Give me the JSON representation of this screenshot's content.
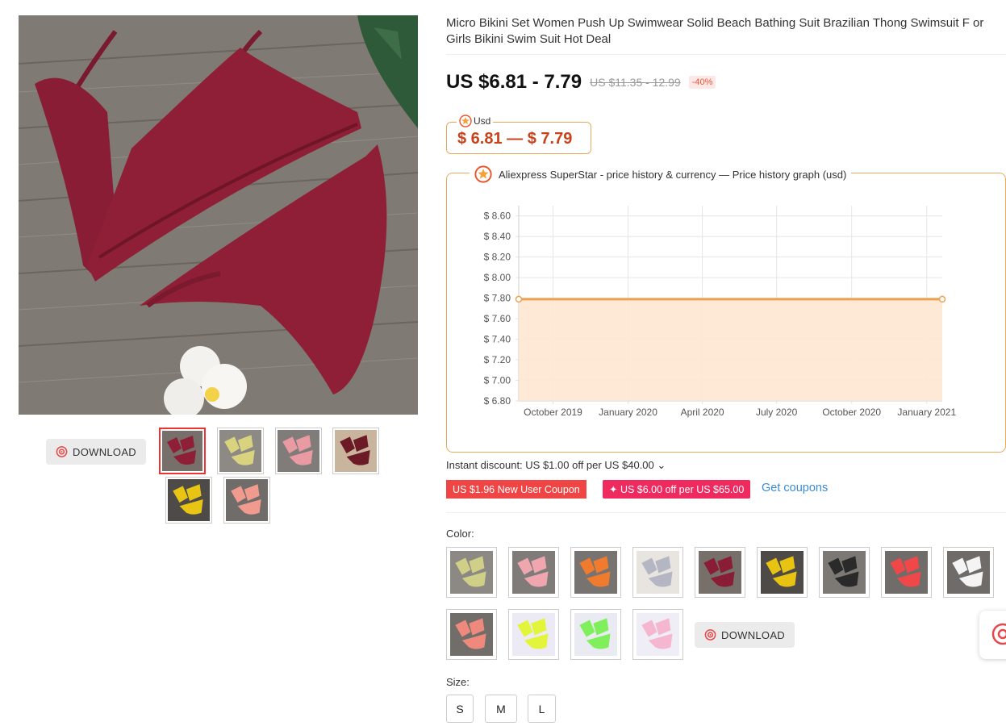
{
  "product": {
    "title": "Micro Bikini Set Women Push Up Swimwear Solid Beach Bathing Suit Brazilian Thong Swimsuit F or Girls Bikini Swim Suit Hot Deal",
    "price": "US $6.81 - 7.79",
    "old_price": "US $11.35 - 12.99",
    "discount": "-40%"
  },
  "gallery": {
    "download_label": "DOWNLOAD",
    "thumbnails": [
      {
        "color": "#8e1f37",
        "bg": "#77706a",
        "active": true
      },
      {
        "color": "#d9d27e",
        "bg": "#8d8a86",
        "active": false
      },
      {
        "color": "#e99aa2",
        "bg": "#807c79",
        "active": false
      },
      {
        "color": "#6b1a26",
        "bg": "#c9b49e",
        "active": false
      },
      {
        "color": "#e8c514",
        "bg": "#4d4a47",
        "active": false
      },
      {
        "color": "#f19a8e",
        "bg": "#6f6c69",
        "active": false
      }
    ]
  },
  "widget": {
    "currency_tag": "Usd",
    "currency_range": "$ 6.81 — $ 7.79",
    "chart_title": "Aliexpress SuperStar - price history & currency — Price history graph (usd)"
  },
  "chart_data": {
    "type": "area",
    "x": [
      "2019-08-20",
      "2021-01-20"
    ],
    "series": [
      {
        "values": [
          7.79,
          7.79
        ]
      }
    ],
    "ylim": [
      6.8,
      8.7
    ],
    "yticks": [
      "$ 8.60",
      "$ 8.40",
      "$ 8.20",
      "$ 8.00",
      "$ 7.80",
      "$ 7.60",
      "$ 7.40",
      "$ 7.20",
      "$ 7.00",
      "$ 6.80"
    ],
    "ytick_values": [
      8.6,
      8.4,
      8.2,
      8.0,
      7.8,
      7.6,
      7.4,
      7.2,
      7.0,
      6.8
    ],
    "xticks": [
      "October 2019",
      "January 2020",
      "April 2020",
      "July 2020",
      "October 2020",
      "January 2021"
    ],
    "xtick_values": [
      "2019-10-01",
      "2020-01-01",
      "2020-04-01",
      "2020-07-01",
      "2020-10-01",
      "2021-01-01"
    ],
    "grid": true,
    "line_color": "#eda24f",
    "fill_color": "#fde7d2"
  },
  "promotions": {
    "instant_discount": "Instant discount: US $1.00 off per US $40.00 ⌄",
    "coupon_new_user": "US $1.96 New User Coupon",
    "coupon_off": "✦ US $6.00 off per US $65.00",
    "get_coupons": "Get coupons"
  },
  "color_section": {
    "label": "Color:",
    "options": [
      {
        "color": "#cfcf88",
        "bg": "#8c8985"
      },
      {
        "color": "#f0a6ae",
        "bg": "#7f7b78"
      },
      {
        "color": "#f07a2d",
        "bg": "#777370"
      },
      {
        "color": "#b4b6c4",
        "bg": "#e8e4e0"
      },
      {
        "color": "#8a1d36",
        "bg": "#77706a"
      },
      {
        "color": "#e9c312",
        "bg": "#4d4a47"
      },
      {
        "color": "#2a2a2a",
        "bg": "#7c7975"
      },
      {
        "color": "#f04848",
        "bg": "#6f6c69"
      },
      {
        "color": "#f4f4f4",
        "bg": "#6e6b68"
      },
      {
        "color": "#f0897d",
        "bg": "#716e6a"
      },
      {
        "color": "#e3f53a",
        "bg": "#ebeaf5"
      },
      {
        "color": "#7ff05c",
        "bg": "#eaeaf3"
      },
      {
        "color": "#f4b7cf",
        "bg": "#efeef6"
      }
    ],
    "download_label": "DOWNLOAD"
  },
  "size_section": {
    "label": "Size:",
    "options": [
      "S",
      "M",
      "L"
    ]
  }
}
